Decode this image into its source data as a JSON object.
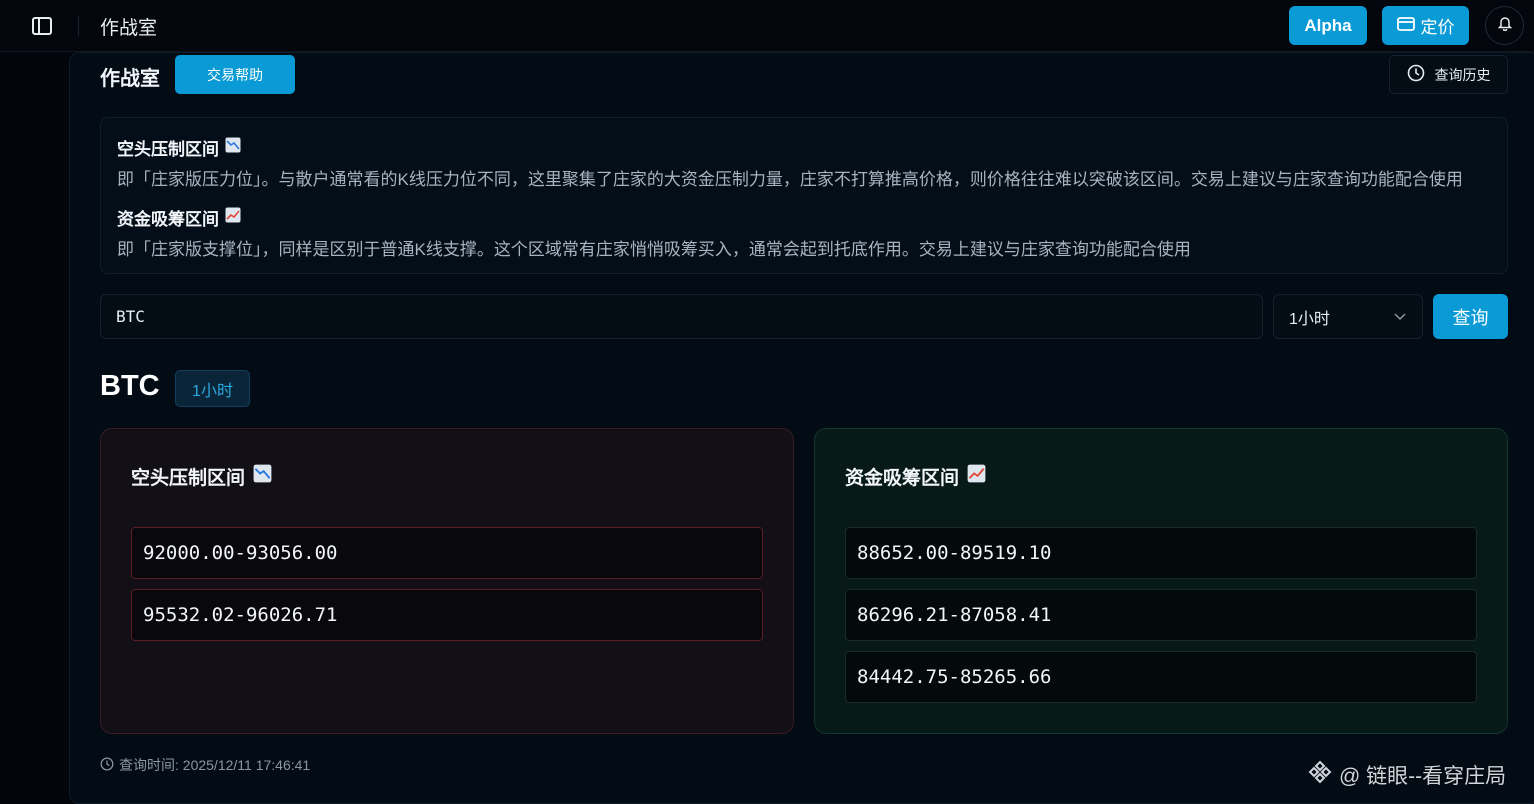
{
  "header": {
    "title": "作战室",
    "alpha_label": "Alpha",
    "pricing_label": "定价"
  },
  "page": {
    "title": "作战室",
    "help_label": "交易帮助",
    "history_label": "查询历史"
  },
  "info": {
    "short_heading": "空头压制区间",
    "short_text": "即「庄家版压力位」。与散户通常看的K线压力位不同，这里聚集了庄家的大资金压制力量，庄家不打算推高价格，则价格往往难以突破该区间。交易上建议与庄家查询功能配合使用",
    "long_heading": "资金吸筹区间",
    "long_text": "即「庄家版支撑位」，同样是区别于普通K线支撑。这个区域常有庄家悄悄吸筹买入，通常会起到托底作用。交易上建议与庄家查询功能配合使用"
  },
  "search": {
    "symbol_value": "BTC",
    "interval_value": "1小时",
    "query_label": "查询"
  },
  "result": {
    "symbol": "BTC",
    "interval": "1小时",
    "short_title": "空头压制区间",
    "short_zones": [
      "92000.00-93056.00",
      "95532.02-96026.71"
    ],
    "long_title": "资金吸筹区间",
    "long_zones": [
      "88652.00-89519.10",
      "86296.21-87058.41",
      "84442.75-85265.66"
    ],
    "query_time": "查询时间: 2025/12/11 17:46:41"
  },
  "watermark": "@ 链眼--看穿庄局",
  "colors": {
    "accent": "#0a9bd6",
    "short_border": "#5a1d22",
    "long_bg": "#071a18"
  }
}
